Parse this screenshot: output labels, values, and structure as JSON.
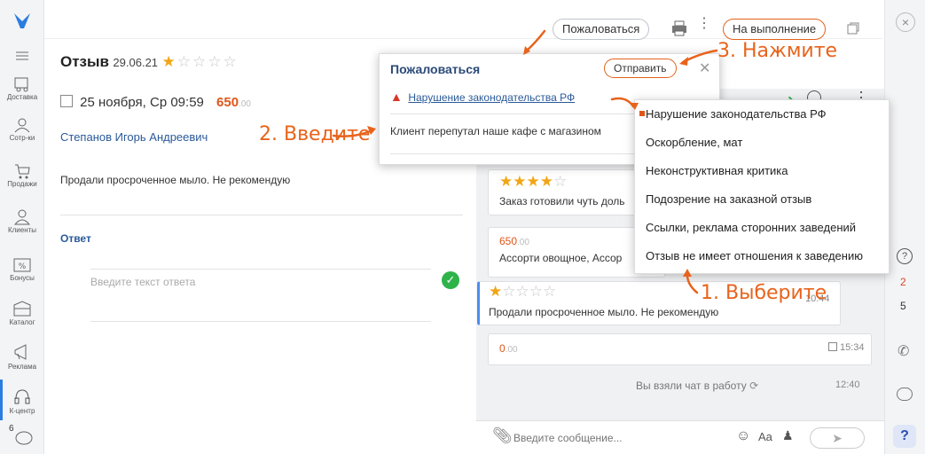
{
  "nav": {
    "items": [
      {
        "label": "Доставка"
      },
      {
        "label": "Сотр-ки"
      },
      {
        "label": "Продажи"
      },
      {
        "label": "Клиенты"
      },
      {
        "label": "Бонусы"
      },
      {
        "label": "Каталог"
      },
      {
        "label": "Реклама"
      },
      {
        "label": "К-центр"
      }
    ],
    "counter": "6"
  },
  "header": {
    "title": "Отзыв",
    "date": "29.06.21",
    "rating": 1,
    "complain_label": "Пожаловаться",
    "execute_label": "На выполнение"
  },
  "review": {
    "datetime": "25 ноября, Ср 09:59",
    "price": "650",
    "price_cents": ".00",
    "author": "Степанов Игорь Андреевич",
    "text": "Продали просроченное мыло. Не рекомендую",
    "answer_heading": "Ответ",
    "answer_placeholder": "Введите текст ответа"
  },
  "complaint_popup": {
    "title": "Пожаловаться",
    "send_label": "Отправить",
    "selected_reason": "Нарушение законодательства РФ",
    "comment": "Клиент перепутал наше кафе с магазином"
  },
  "reasons": {
    "items": [
      "Нарушение законодательства РФ",
      "Оскорбление, мат",
      "Неконструктивная критика",
      "Подозрение на заказной отзыв",
      "Ссылки, реклама сторонних заведений",
      "Отзыв не имеет отношения к заведению"
    ],
    "selected": 0
  },
  "chat": {
    "card1_rating": 4,
    "card1_text": "Заказ готовили чуть доль",
    "card2_price": "650",
    "card2_cents": ".00",
    "card2_text": "Ассорти овощное, Ассор",
    "card3_rating": 1,
    "card3_text": "Продали просроченное мыло. Не рекомендую",
    "card3_time": "10:44",
    "card4_price": "0",
    "card4_cents": ".00",
    "card4_time": "15:34",
    "system_text": "Вы взяли чат в работу",
    "system_time": "12:40",
    "input_placeholder": "Введите сообщение...",
    "font_label": "Aa"
  },
  "rail": {
    "count_red": "2",
    "count_black": "5"
  },
  "annotations": {
    "step1": "1. Выберите",
    "step2": "2. Введите",
    "step3": "3. Нажмите"
  },
  "colors": {
    "accent": "#e2621b",
    "link": "#2a5a99",
    "star": "#f2a516",
    "success": "#2db34a"
  }
}
